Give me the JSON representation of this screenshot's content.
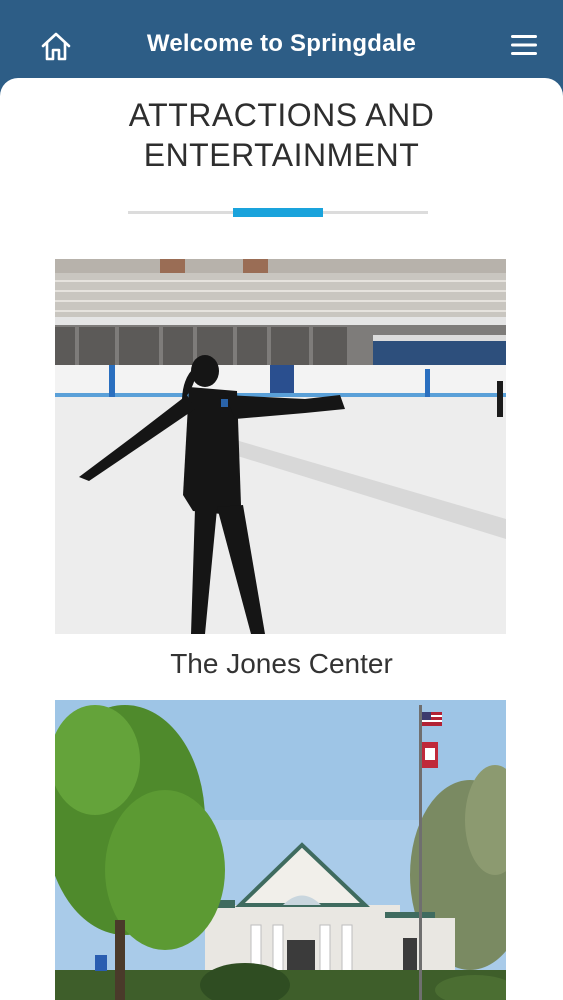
{
  "header": {
    "title": "Welcome to Springdale",
    "home_icon": "home-icon",
    "menu_icon": "hamburger-menu-icon",
    "background_color": "#2d5d86"
  },
  "page": {
    "heading_line1": "ATTRACTIONS AND",
    "heading_line2": "ENTERTAINMENT",
    "accent_color": "#1aa3dc"
  },
  "attractions": [
    {
      "name": "The Jones Center",
      "image": "ice-skater-photo"
    },
    {
      "name": "",
      "image": "building-with-flags-photo"
    }
  ]
}
